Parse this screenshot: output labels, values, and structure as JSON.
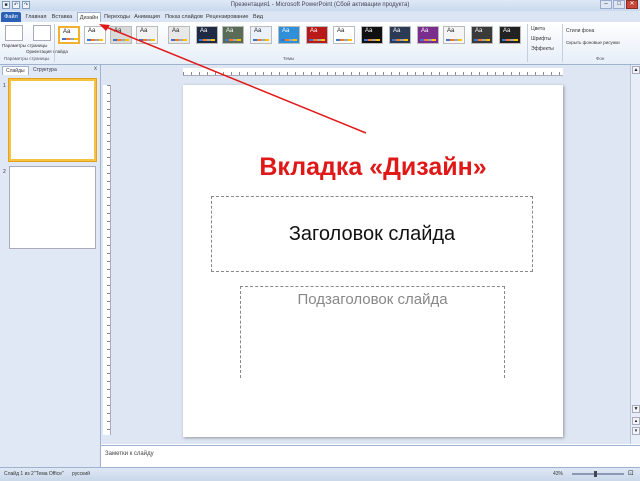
{
  "window": {
    "title": "Презентация1 - Microsoft PowerPoint (Сбой активации продукта)",
    "controls": [
      "–",
      "□",
      "✕"
    ]
  },
  "quick_access": [
    "save-icon",
    "undo-icon",
    "redo-icon"
  ],
  "tabs": [
    {
      "label": "Файл",
      "kind": "file"
    },
    {
      "label": "Главная",
      "kind": "normal"
    },
    {
      "label": "Вставка",
      "kind": "normal"
    },
    {
      "label": "Дизайн",
      "kind": "active"
    },
    {
      "label": "Переходы",
      "kind": "normal"
    },
    {
      "label": "Анимация",
      "kind": "normal"
    },
    {
      "label": "Показ слайдов",
      "kind": "normal"
    },
    {
      "label": "Рецензирование",
      "kind": "normal"
    },
    {
      "label": "Вид",
      "kind": "normal"
    }
  ],
  "ribbon": {
    "page_setup": {
      "buttons": [
        "Параметры страницы",
        "Ориентация слайда"
      ],
      "group_label": "Параметры страницы"
    },
    "themes_group_label": "Темы",
    "theme_sample": "Aa",
    "theme_options": [
      "Цвета",
      "Шрифты",
      "Эффекты"
    ],
    "background": {
      "styles_label": "Стили фона",
      "hide_label": "Скрыть фоновые рисунки",
      "group_label": "Фон"
    }
  },
  "left_panel": {
    "tabs": [
      "Слайды",
      "Структура"
    ],
    "close": "x",
    "slides": [
      "1",
      "2"
    ]
  },
  "slide": {
    "annotation": "Вкладка «Дизайн»",
    "title_placeholder": "Заголовок слайда",
    "subtitle_placeholder": "Подзаголовок слайда"
  },
  "notes_placeholder": "Заметки к слайду",
  "status": {
    "slide_counter": "Слайд 1 из 2",
    "theme_name": "\"Тема Office\"",
    "language": "русский",
    "zoom": "43%",
    "zoom_fraction": 0.43
  },
  "colors": {
    "file_tab": "#2a61b4",
    "annotation": "#e01818",
    "selected_thumb": "#f5c242"
  }
}
